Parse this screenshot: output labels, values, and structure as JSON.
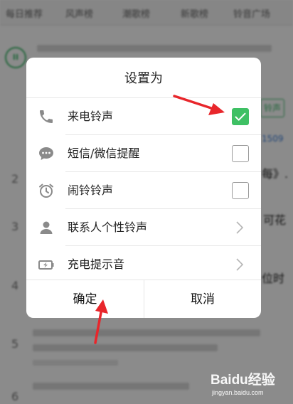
{
  "background": {
    "tabs": [
      "每日推荐",
      "风声榜",
      "潮歌榜",
      "新歌榜",
      "铃音广场"
    ],
    "edge_fragments": [
      "每》.",
      "可花",
      "位时"
    ],
    "badge": "铃声",
    "link": "1509",
    "row_numbers": [
      "2",
      "3",
      "4",
      "5",
      "6"
    ],
    "play_label": "II"
  },
  "dialog": {
    "title": "设置为",
    "options": [
      {
        "label": "来电铃声",
        "icon": "phone-icon",
        "control": "checkbox",
        "checked": true
      },
      {
        "label": "短信/微信提醒",
        "icon": "chat-bubble-icon",
        "control": "checkbox",
        "checked": false
      },
      {
        "label": "闹铃铃声",
        "icon": "alarm-clock-icon",
        "control": "checkbox",
        "checked": false
      },
      {
        "label": "联系人个性铃声",
        "icon": "contact-person-icon",
        "control": "chevron"
      },
      {
        "label": "充电提示音",
        "icon": "battery-charging-icon",
        "control": "chevron"
      }
    ],
    "confirm_label": "确定",
    "cancel_label": "取消"
  },
  "watermark": {
    "text": "Baidu经验",
    "url": "jingyan.baidu.com"
  },
  "colors": {
    "accent": "#3ec064",
    "annotation_arrow": "#e8262b"
  }
}
